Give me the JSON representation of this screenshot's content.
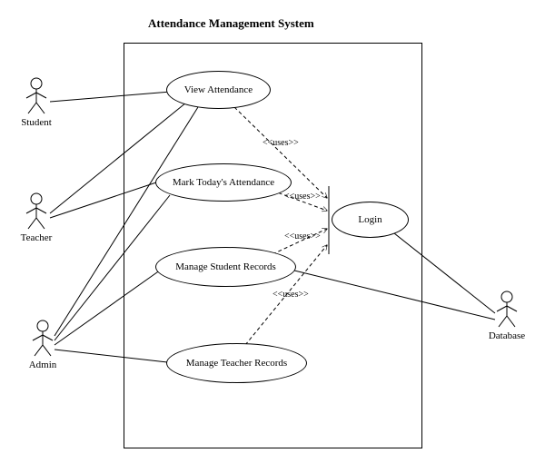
{
  "title": "Attendance Management System",
  "actors": {
    "student": "Student",
    "teacher": "Teacher",
    "admin": "Admin",
    "database": "Database"
  },
  "usecases": {
    "view": "View Attendance",
    "mark": "Mark Today's Attendance",
    "manageStudent": "Manage Student Records",
    "manageTeacher": "Manage Teacher Records",
    "login": "Login"
  },
  "stereotype": "<<uses>>"
}
